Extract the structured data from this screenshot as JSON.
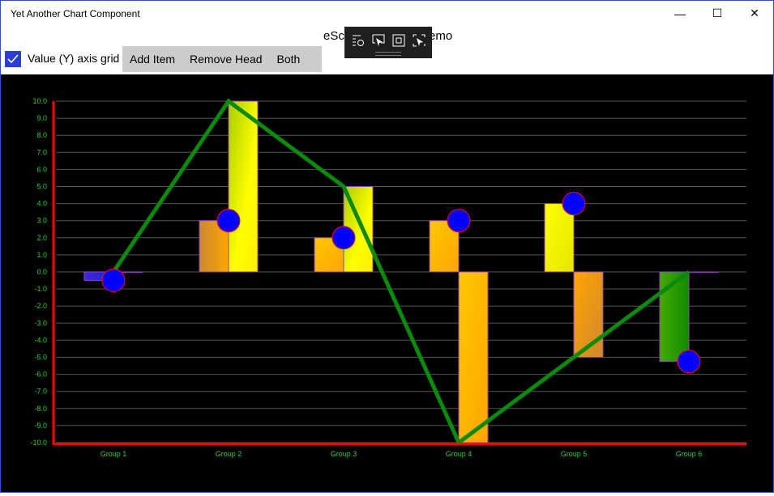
{
  "window": {
    "title": "Yet Another Chart Component",
    "minimize": "—",
    "maximize": "☐",
    "close": "✕"
  },
  "page": {
    "title_left": "eSc",
    "title_right": "emo"
  },
  "controls": {
    "gridlines_checkbox": {
      "label": "Value (Y) axis grid",
      "checked": true
    },
    "buttons": [
      "Add Item",
      "Remove Head",
      "Both"
    ]
  },
  "debug_toolbar": {
    "icons": [
      "live-visual-tree-icon",
      "select-element-icon",
      "display-layout-adorners-icon",
      "track-focus-icon"
    ]
  },
  "colors": {
    "axis": "#ff0000",
    "line": "#0a8a0a",
    "marker_fill": "#0000ff",
    "marker_stroke": "#ff0000",
    "bar_stroke": "#9a40c0",
    "label": "#33cc33",
    "grid": "#555555"
  },
  "chart_data": {
    "type": "bar",
    "categories": [
      "Group 1",
      "Group 2",
      "Group 3",
      "Group 4",
      "Group 5",
      "Group 6"
    ],
    "ylim": [
      -10,
      10
    ],
    "yticks": [
      "10.0",
      "9.0",
      "8.0",
      "7.0",
      "6.0",
      "5.0",
      "4.0",
      "3.0",
      "2.0",
      "1.0",
      "0.0",
      "-1.0",
      "-2.0",
      "-3.0",
      "-4.0",
      "-5.0",
      "-6.0",
      "-7.0",
      "-8.0",
      "-9.0",
      "-10.0"
    ],
    "grid": true,
    "series": [
      {
        "type": "bar",
        "values": [
          -0.5,
          3,
          2,
          3,
          4,
          -5.25
        ]
      },
      {
        "type": "bar",
        "values": [
          0,
          10,
          5,
          -10,
          -5,
          0
        ]
      },
      {
        "type": "scatter",
        "values": [
          -0.5,
          3,
          2,
          3,
          4,
          -5.25
        ]
      },
      {
        "type": "line",
        "values": [
          0,
          10,
          5,
          -10,
          -5,
          0
        ]
      }
    ]
  }
}
